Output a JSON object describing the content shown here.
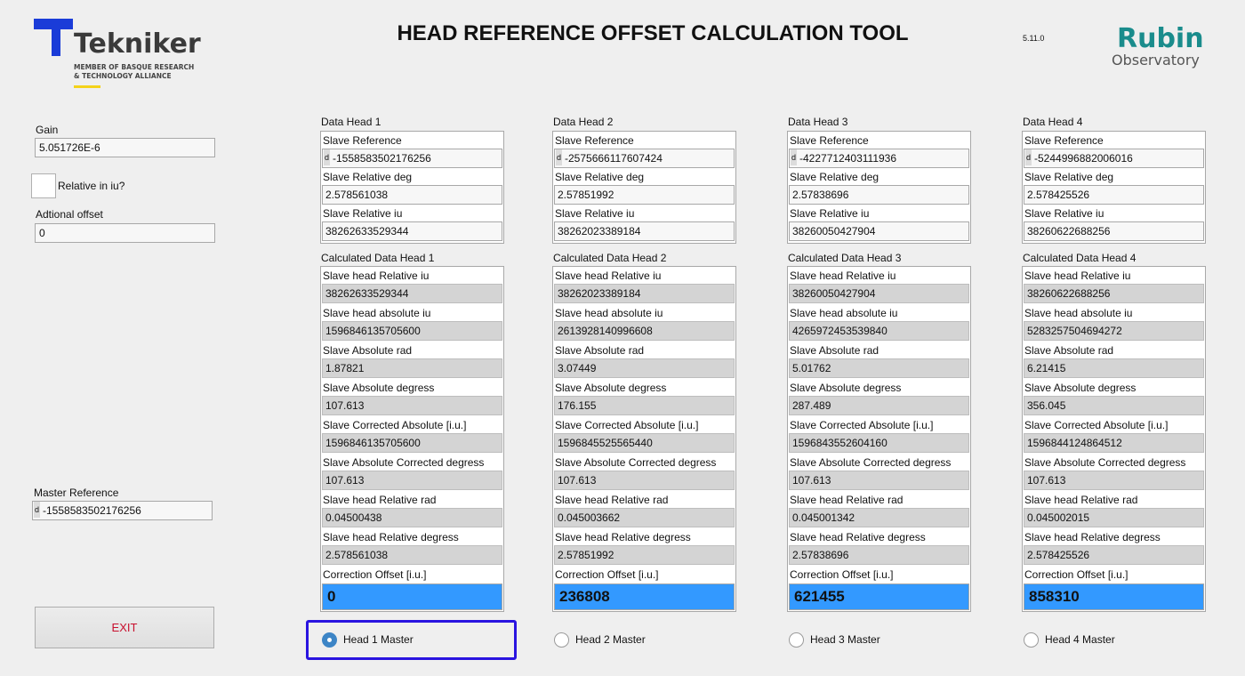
{
  "header": {
    "title": "HEAD REFERENCE OFFSET CALCULATION TOOL",
    "version": "5.11.0",
    "tekniker_name": "Tekniker",
    "tekniker_sub_1": "MEMBER OF BASQUE RESEARCH",
    "tekniker_sub_2": "& TECHNOLOGY ALLIANCE",
    "rubin_name": "Rubin",
    "rubin_sub": "Observatory"
  },
  "left": {
    "gain_label": "Gain",
    "gain_value": "5.051726E-6",
    "relative_label": "Relative in iu?",
    "relative_checked": false,
    "offset_label": "Adtional offset",
    "offset_value": "0",
    "master_ref_label": "Master Reference",
    "master_ref_tag": "d",
    "master_ref_value": "-1558583502176256",
    "exit_label": "EXIT"
  },
  "labels": {
    "slave_reference": "Slave Reference",
    "slave_relative_deg": "Slave Relative deg",
    "slave_relative_iu": "Slave Relative iu",
    "calc_rows": [
      "Slave head Relative iu",
      "Slave head absolute iu",
      "Slave Absolute rad",
      "Slave Absolute degress",
      "Slave Corrected Absolute [i.u.]",
      "Slave Absolute Corrected degress",
      "Slave head Relative rad",
      "Slave head Relative degress"
    ],
    "correction_offset": "Correction Offset [i.u.]",
    "d_tag": "d"
  },
  "heads": [
    {
      "data_title": "Data Head 1",
      "slave_reference": "-1558583502176256",
      "slave_relative_deg": "2.578561038",
      "slave_relative_iu": "38262633529344",
      "calc_title": "Calculated Data Head 1",
      "calc": [
        "38262633529344",
        "1596846135705600",
        "1.87821",
        "107.613",
        "1596846135705600",
        "107.613",
        "0.04500438",
        "2.578561038"
      ],
      "correction_offset": "0",
      "radio_label": "Head 1 Master",
      "selected": true
    },
    {
      "data_title": "Data Head 2",
      "slave_reference": "-2575666117607424",
      "slave_relative_deg": "2.57851992",
      "slave_relative_iu": "38262023389184",
      "calc_title": "Calculated Data Head 2",
      "calc": [
        "38262023389184",
        "2613928140996608",
        "3.07449",
        "176.155",
        "1596845525565440",
        "107.613",
        "0.045003662",
        "2.57851992"
      ],
      "correction_offset": "236808",
      "radio_label": "Head 2 Master",
      "selected": false
    },
    {
      "data_title": "Data Head 3",
      "slave_reference": "-4227712403111936",
      "slave_relative_deg": "2.57838696",
      "slave_relative_iu": "38260050427904",
      "calc_title": "Calculated Data Head 3",
      "calc": [
        "38260050427904",
        "4265972453539840",
        "5.01762",
        "287.489",
        "1596843552604160",
        "107.613",
        "0.045001342",
        "2.57838696"
      ],
      "correction_offset": "621455",
      "radio_label": "Head 3 Master",
      "selected": false
    },
    {
      "data_title": "Data Head 4",
      "slave_reference": "-5244996882006016",
      "slave_relative_deg": "2.578425526",
      "slave_relative_iu": "38260622688256",
      "calc_title": "Calculated Data Head 4",
      "calc": [
        "38260622688256",
        "5283257504694272",
        "6.21415",
        "356.045",
        "1596844124864512",
        "107.613",
        "0.045002015",
        "2.578425526"
      ],
      "correction_offset": "858310",
      "radio_label": "Head 4 Master",
      "selected": false
    }
  ]
}
